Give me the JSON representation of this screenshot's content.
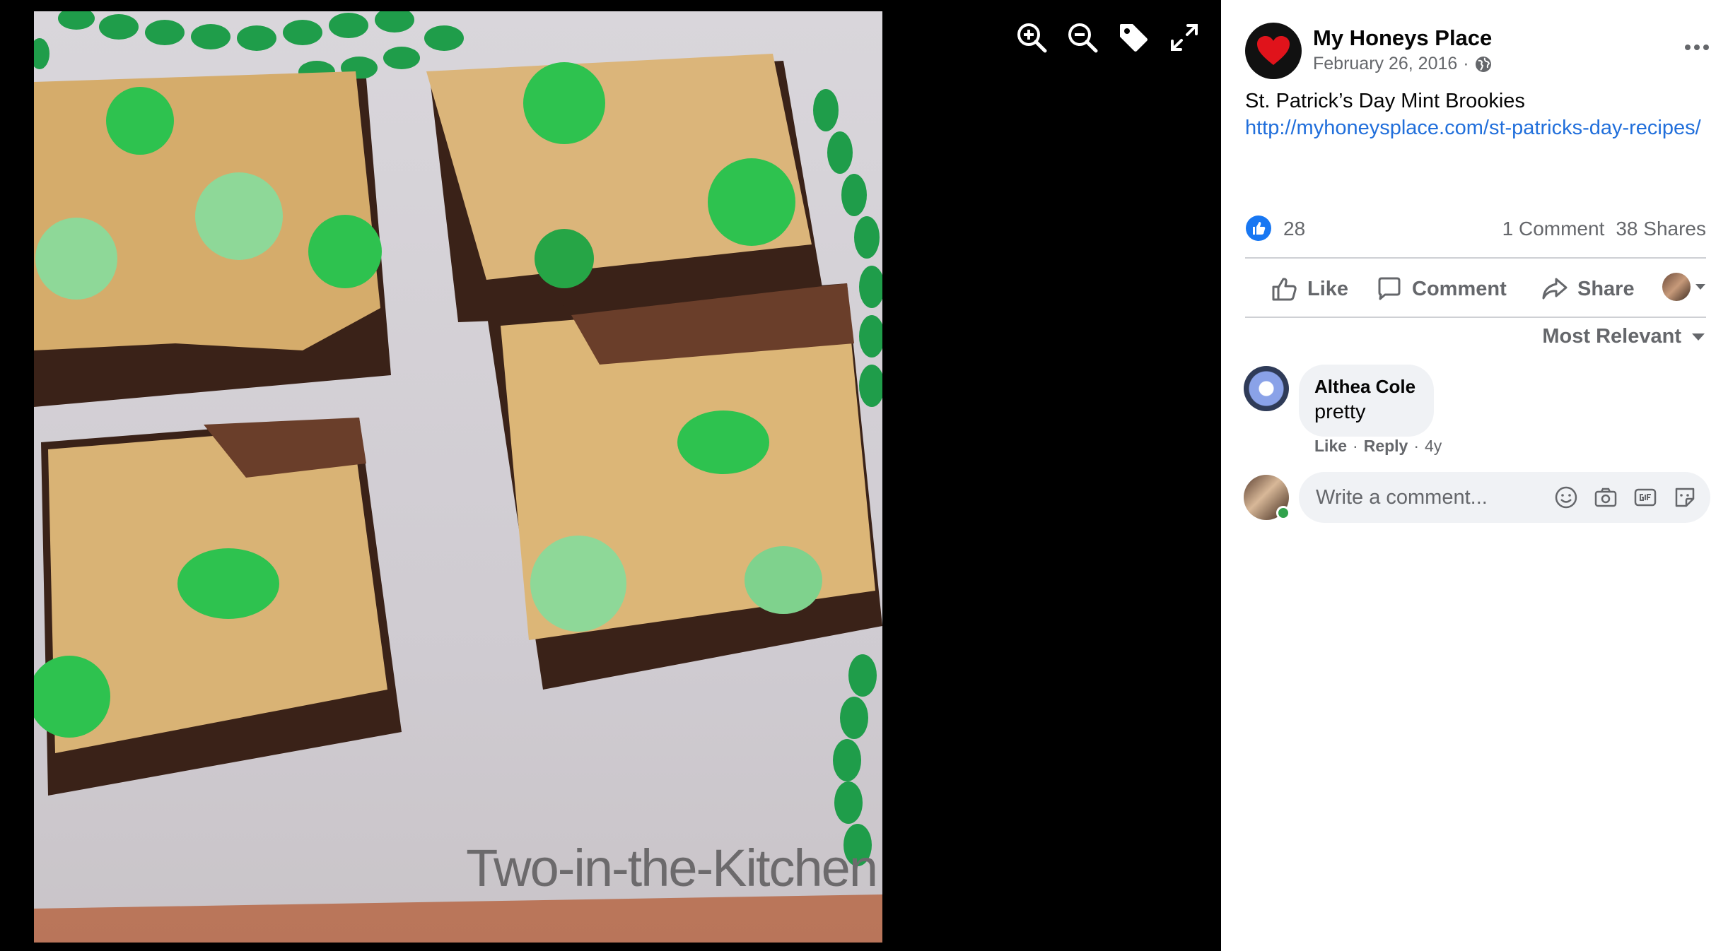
{
  "viewer": {
    "watermark": "Two-in-the-Kitchen",
    "tools": [
      "zoom-in-icon",
      "zoom-out-icon",
      "tag-icon",
      "fullscreen-icon"
    ]
  },
  "post": {
    "page_name": "My Honeys Place",
    "date": "February 26, 2016",
    "meta_separator": "·",
    "audience_icon": "globe-icon",
    "text": "St. Patrick’s Day Mint Brookies",
    "link": "http://myhoneysplace.com/st-patricks-day-recipes/",
    "reactions": {
      "count": "28",
      "comments": "1 Comment",
      "shares": "38 Shares"
    },
    "actions": {
      "like": "Like",
      "comment": "Comment",
      "share": "Share"
    },
    "sort_label": "Most Relevant"
  },
  "comments": [
    {
      "name": "Althea Cole",
      "text": "pretty",
      "like": "Like",
      "reply": "Reply",
      "time": "4y",
      "sep": "·"
    }
  ],
  "composer": {
    "placeholder": "Write a comment...",
    "icons": [
      "emoji-icon",
      "camera-icon",
      "gif-icon",
      "sticker-icon"
    ]
  },
  "colors": {
    "link": "#216fdb",
    "accent": "#1877f2",
    "muted": "#65676b",
    "online": "#31a24c"
  }
}
